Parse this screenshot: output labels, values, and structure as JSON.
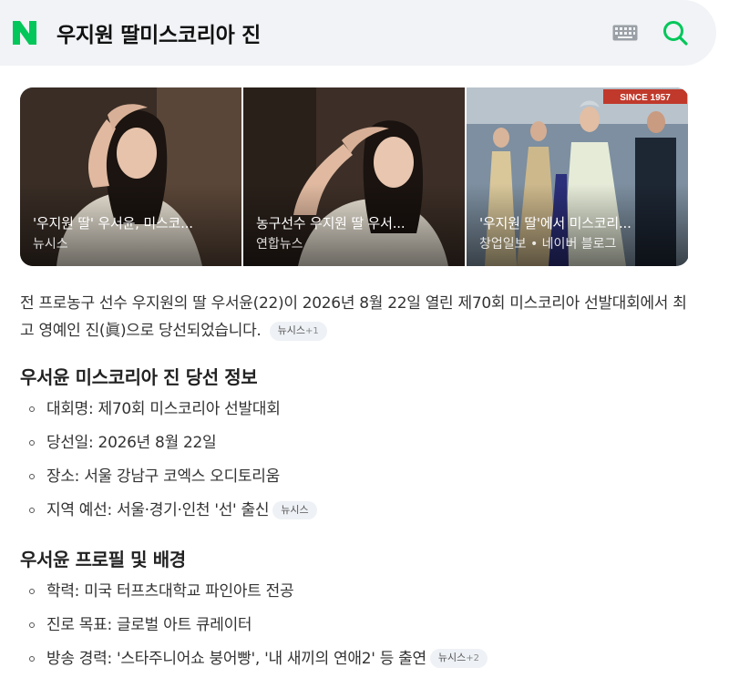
{
  "search": {
    "query": "우지원 딸미스코리아 진",
    "logo_letter": "N",
    "icons": [
      "naver-logo-icon",
      "keyboard-icon",
      "search-icon"
    ],
    "accent_color": "#03c75a"
  },
  "images": [
    {
      "caption": "'우지원 딸' 우서윤, 미스코...",
      "source": "뉴시스"
    },
    {
      "caption": "농구선수 우지원 딸 우서...",
      "source": "연합뉴스"
    },
    {
      "caption": "'우지원 딸'에서 미스코리...",
      "source": "창업일보 • 네이버 블로그",
      "overlay_text": "SINCE 1957"
    }
  ],
  "summary": {
    "text": "전 프로농구 선수 우지원의 딸 우서윤(22)이 2026년 8월 22일 열린 제70회 미스코리아 선발대회에서 최고 영예인 진(眞)으로 당선되었습니다.",
    "chip": "뉴시스",
    "chip_extra": "+1"
  },
  "sections": [
    {
      "title": "우서윤 미스코리아 진 당선 정보",
      "items": [
        {
          "text": "대회명: 제70회 미스코리아 선발대회"
        },
        {
          "text": "당선일: 2026년 8월 22일"
        },
        {
          "text": "장소: 서울 강남구 코엑스 오디토리움"
        },
        {
          "text": "지역 예선: 서울·경기·인천 '선' 출신",
          "chip": "뉴시스"
        }
      ]
    },
    {
      "title": "우서윤 프로필 및 배경",
      "items": [
        {
          "text": "학력: 미국 터프츠대학교 파인아트 전공"
        },
        {
          "text": "진로 목표: 글로벌 아트 큐레이터"
        },
        {
          "text": "방송 경력: '스타주니어쇼 붕어빵', '내 새끼의 연애2' 등 출연",
          "chip": "뉴시스",
          "chip_extra": "+2"
        }
      ]
    }
  ]
}
